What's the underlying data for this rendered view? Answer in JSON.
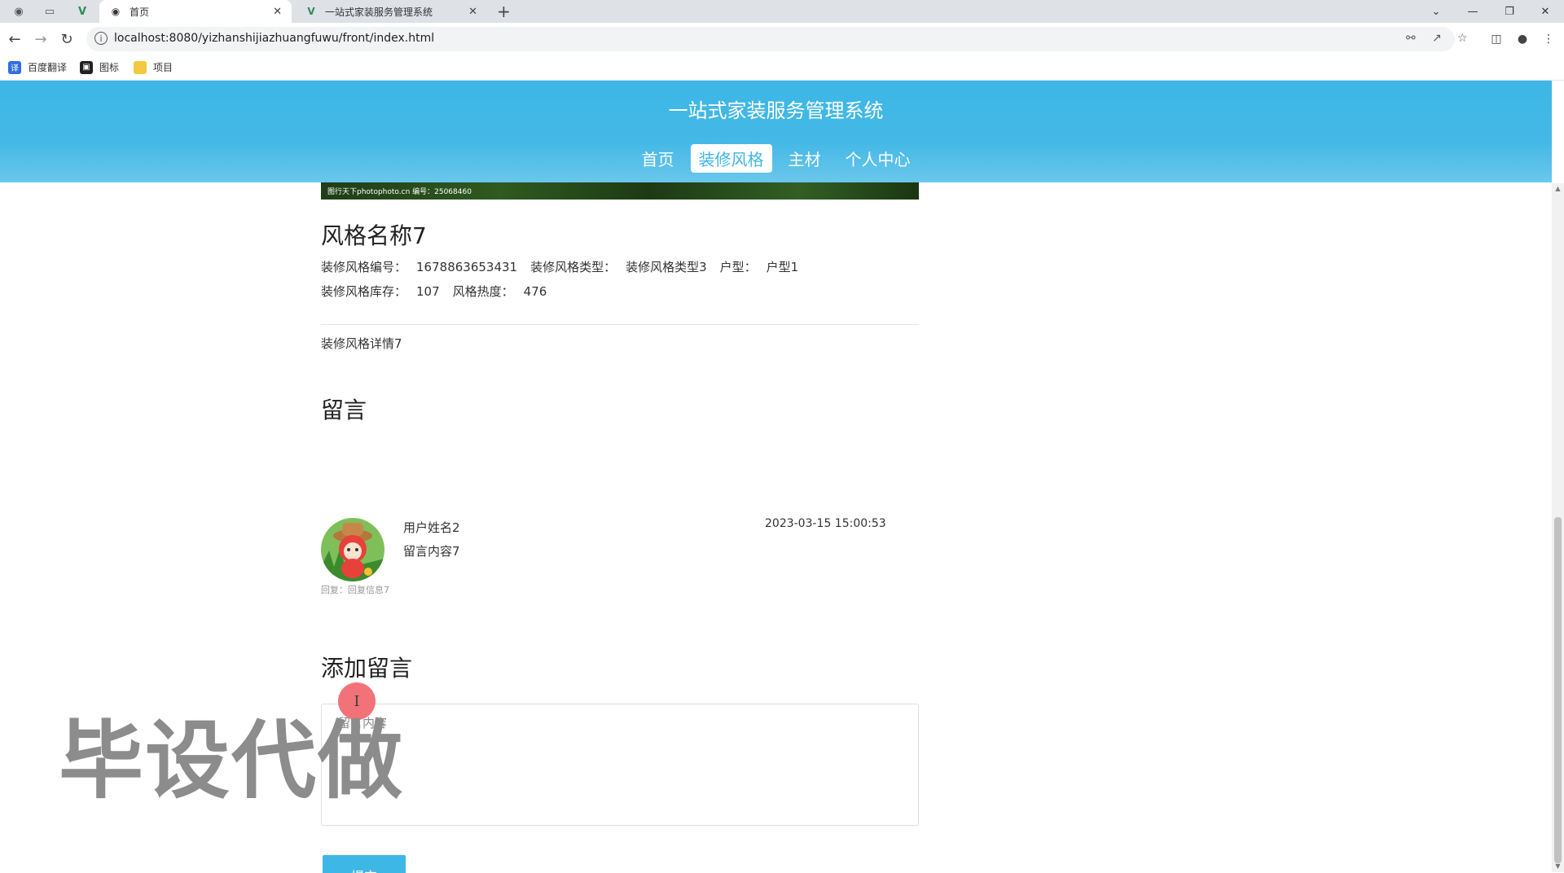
{
  "browser": {
    "tabs": [
      {
        "label": "首页",
        "favicon": "globe-icon",
        "active": true
      },
      {
        "label": "一站式家装服务管理系统",
        "favicon": "vue-logo-icon",
        "active": false
      }
    ],
    "url": "localhost:8080/yizhanshijiazhuangfuwu/front/index.html",
    "bookmarks": [
      {
        "label": "百度翻译",
        "icon": "translate-icon"
      },
      {
        "label": "图标",
        "icon": "picture-icon"
      },
      {
        "label": "项目",
        "icon": "folder-icon"
      }
    ]
  },
  "site": {
    "title": "一站式家装服务管理系统",
    "nav": [
      {
        "label": "首页",
        "active": false
      },
      {
        "label": "装修风格",
        "active": true
      },
      {
        "label": "主材",
        "active": false
      },
      {
        "label": "个人中心",
        "active": false
      }
    ],
    "accent_color": "#3db7e6"
  },
  "hero": {
    "caption": "图行天下photophoto.cn 编号：25068460"
  },
  "style": {
    "name": "风格名称7",
    "code_label": "装修风格编号：",
    "code_value": "1678863653431",
    "type_label": "装修风格类型：",
    "type_value": "装修风格类型3",
    "house_label": "户型：",
    "house_value": "户型1",
    "stock_label": "装修风格库存：",
    "stock_value": "107",
    "heat_label": "风格热度：",
    "heat_value": "476",
    "detail": "装修风格详情7"
  },
  "messages": {
    "heading": "留言",
    "items": [
      {
        "user": "用户姓名2",
        "content": "留言内容7",
        "time": "2023-03-15 15:00:53",
        "reply": "回复：回复信息7"
      }
    ]
  },
  "add_message": {
    "heading": "添加留言",
    "placeholder": "留言内容",
    "submit_label": "提交"
  },
  "watermark": "毕设代做"
}
